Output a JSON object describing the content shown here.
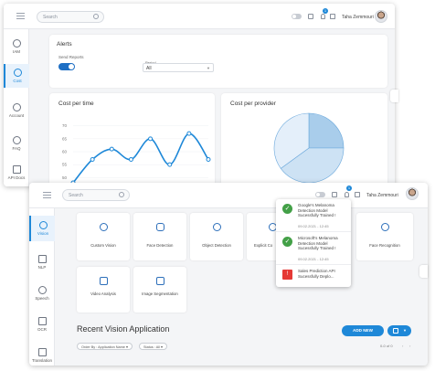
{
  "top": {
    "search_placeholder": "Search",
    "badge_count": "1",
    "user_name": "Taha Zemmouri"
  },
  "w1": {
    "nav": [
      {
        "label": "IAM",
        "icon": "users-icon"
      },
      {
        "label": "Cost",
        "icon": "dollar-icon"
      },
      {
        "label": "Account",
        "icon": "gear-icon"
      },
      {
        "label": "FAQ",
        "icon": "help-icon"
      },
      {
        "label": "API Docs",
        "icon": "document-icon"
      }
    ],
    "alerts": {
      "title": "Alerts",
      "send_reports_label": "Send Reports",
      "period_label": "Period",
      "period_value": "All"
    },
    "cost_per_time": {
      "title": "Cost per time"
    },
    "cost_per_provider": {
      "title": "Cost per provider"
    }
  },
  "chart_data": [
    {
      "type": "line",
      "title": "Cost per time",
      "y_ticks": [
        "70",
        "65",
        "60",
        "55",
        "50"
      ],
      "ylim": [
        48,
        72
      ],
      "values": [
        48,
        57,
        61,
        57,
        65,
        55,
        67,
        57
      ],
      "color": "#1e88d8"
    },
    {
      "type": "pie",
      "title": "Cost per provider",
      "values": [
        25,
        40,
        35
      ],
      "colors": [
        "#a9cdeb",
        "#cde2f4",
        "#e4effa"
      ]
    }
  ],
  "w2": {
    "nav": [
      {
        "label": "Vision",
        "icon": "eye-icon"
      },
      {
        "label": "NLP",
        "icon": "text-icon"
      },
      {
        "label": "Speech",
        "icon": "speaker-icon"
      },
      {
        "label": "OCR",
        "icon": "scan-icon"
      },
      {
        "label": "Translation",
        "icon": "translate-icon"
      }
    ],
    "tiles": [
      {
        "label": "Custom Vision",
        "icon": "eye-icon"
      },
      {
        "label": "Face Detection",
        "icon": "person-icon"
      },
      {
        "label": "Object Detection",
        "icon": "refresh-icon"
      },
      {
        "label": "Explicit Co",
        "icon": "alert-icon"
      },
      {
        "label": "Face Recognition",
        "icon": "face-icon"
      },
      {
        "label": "Video Analysis",
        "icon": "video-icon"
      },
      {
        "label": "Image Segmentation",
        "icon": "puzzle-icon"
      }
    ],
    "notifications": [
      {
        "status": "success",
        "text": "Google's Melanoma Detection Model Sucessfully Trained !",
        "time": "09.02.2021 - 12:45"
      },
      {
        "status": "success",
        "text": "Microsoft's Melanoma Detection Model Sucessfully Trained !",
        "time": "09.02.2021 - 12:45"
      },
      {
        "status": "error",
        "text": "Sales Prediction API Sucessfully Deplo...",
        "time": ""
      }
    ],
    "recent_title": "Recent Vision Application",
    "add_new_label": "ADD NEW",
    "order_by_label": "Order By : Application Name ▾",
    "status_filter_label": "Status : All ▾",
    "pagination": "0-0 of 0",
    "colors": {
      "accent": "#1e88d8",
      "success": "#43a047",
      "error": "#e53935"
    }
  }
}
